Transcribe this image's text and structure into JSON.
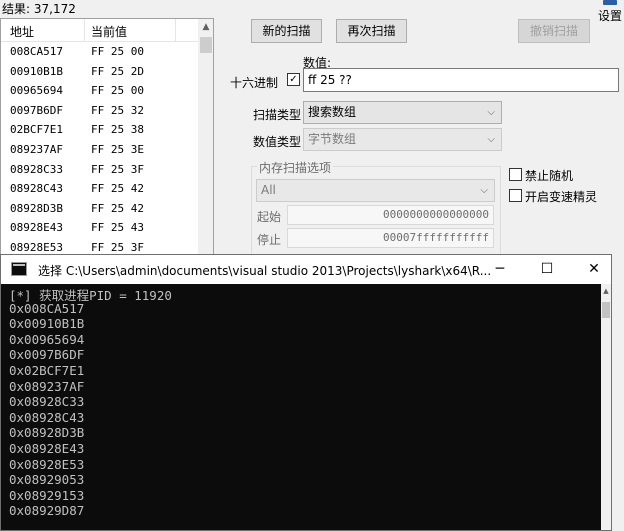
{
  "results_label": "结果: 37,172",
  "settings_label": "设置",
  "list": {
    "columns": [
      "地址",
      "当前值"
    ],
    "rows": [
      {
        "address": "008CA517",
        "value": "FF 25 00"
      },
      {
        "address": "00910B1B",
        "value": "FF 25 2D"
      },
      {
        "address": "00965694",
        "value": "FF 25 00"
      },
      {
        "address": "0097B6DF",
        "value": "FF 25 32"
      },
      {
        "address": "02BCF7E1",
        "value": "FF 25 38"
      },
      {
        "address": "089237AF",
        "value": "FF 25 3E"
      },
      {
        "address": "08928C33",
        "value": "FF 25 3F"
      },
      {
        "address": "08928C43",
        "value": "FF 25 42"
      },
      {
        "address": "08928D3B",
        "value": "FF 25 42"
      },
      {
        "address": "08928E43",
        "value": "FF 25 43"
      },
      {
        "address": "08928E53",
        "value": "FF 25 3F"
      }
    ]
  },
  "buttons": {
    "new_scan": "新的扫描",
    "next_scan": "再次扫描",
    "undo_scan": "撤销扫描"
  },
  "value": {
    "label": "数值:",
    "hex_label": "十六进制",
    "hex_checked": "✓",
    "input_value": "ff 25 ??"
  },
  "scan_type": {
    "label": "扫描类型",
    "selected": "搜索数组"
  },
  "value_type": {
    "label": "数值类型",
    "selected": "字节数组"
  },
  "memory_options": {
    "title": "内存扫描选项",
    "region_selected": "All",
    "start_label": "起始",
    "start_value": "0000000000000000",
    "stop_label": "停止",
    "stop_value": "00007fffffffffff"
  },
  "options": {
    "disable_random": "禁止随机",
    "enable_speedhack": "开启变速精灵"
  },
  "console": {
    "title": "选择 C:\\Users\\admin\\documents\\visual studio 2013\\Projects\\lyshark\\x64\\R...",
    "lines": [
      "[*] 获取进程PID = 11920",
      "0x008CA517",
      "0x00910B1B",
      "0x00965694",
      "0x0097B6DF",
      "0x02BCF7E1",
      "0x089237AF",
      "0x08928C33",
      "0x08928C43",
      "0x08928D3B",
      "0x08928E43",
      "0x08928E53",
      "0x08929053",
      "0x08929153",
      "0x08929D87"
    ],
    "minimize": "─",
    "maximize": "☐",
    "close": "✕"
  },
  "colors": {
    "console_bg": "#0c0c0c",
    "console_text": "#c0c0c0",
    "window_bg": "#f0f0f0"
  }
}
